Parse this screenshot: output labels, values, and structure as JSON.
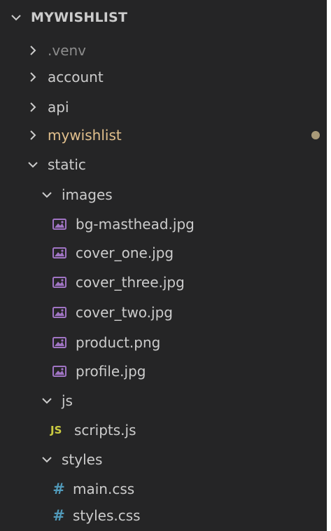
{
  "explorer": {
    "title": "MYWISHLIST",
    "items": [
      {
        "label": "venv",
        "kind": "folder",
        "state": "collapsed"
      },
      {
        "label": "account",
        "kind": "folder",
        "state": "collapsed"
      },
      {
        "label": "api",
        "kind": "folder",
        "state": "collapsed"
      },
      {
        "label": "mywishlist",
        "kind": "folder",
        "state": "collapsed",
        "modified": true
      },
      {
        "label": "static",
        "kind": "folder",
        "state": "expanded"
      },
      {
        "label": "images",
        "kind": "folder",
        "state": "expanded"
      },
      {
        "label": "bg-masthead.jpg",
        "kind": "image-file"
      },
      {
        "label": "cover_one.jpg",
        "kind": "image-file"
      },
      {
        "label": "cover_three.jpg",
        "kind": "image-file"
      },
      {
        "label": "cover_two.jpg",
        "kind": "image-file"
      },
      {
        "label": "product.png",
        "kind": "image-file"
      },
      {
        "label": "profile.jpg",
        "kind": "image-file"
      },
      {
        "label": "js",
        "kind": "folder",
        "state": "expanded"
      },
      {
        "label": "scripts.js",
        "kind": "js-file",
        "icon_text": "JS"
      },
      {
        "label": "styles",
        "kind": "folder",
        "state": "expanded"
      },
      {
        "label": "main.css",
        "kind": "css-file",
        "icon_text": "#"
      },
      {
        "label": "styles.css",
        "kind": "css-file",
        "icon_text": "#"
      }
    ]
  },
  "colors": {
    "background": "#252526",
    "text": "#cccccc",
    "dim_text": "#8c8c8c",
    "modified_text": "#e2c08d",
    "modified_dot": "#a99a78",
    "js_icon": "#cbcb41",
    "css_icon": "#519aba",
    "image_icon": "#a074c4"
  },
  "icons": {
    "collapsed": "chevron-right-icon",
    "expanded": "chevron-down-icon",
    "image": "image-file-icon",
    "js": "js-file-icon",
    "css": "css-file-icon"
  }
}
